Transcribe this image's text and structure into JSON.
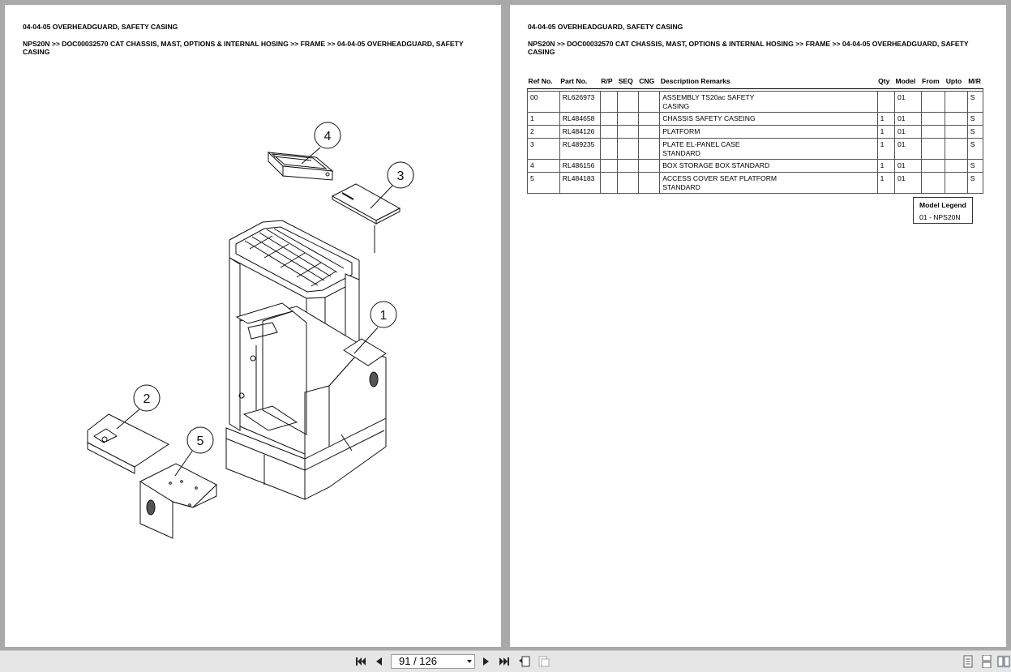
{
  "left_page": {
    "title": "04-04-05 OVERHEADGUARD, SAFETY CASING",
    "breadcrumb": "NPS20N >> DOC00032570 CAT CHASSIS, MAST, OPTIONS & INTERNAL HOSING >> FRAME >> 04-04-05 OVERHEADGUARD, SAFETY CASING",
    "callouts": [
      "4",
      "3",
      "1",
      "2",
      "5"
    ]
  },
  "right_page": {
    "title": "04-04-05 OVERHEADGUARD, SAFETY CASING",
    "breadcrumb": "NPS20N >> DOC00032570 CAT CHASSIS, MAST, OPTIONS & INTERNAL HOSING >> FRAME >> 04-04-05 OVERHEADGUARD, SAFETY CASING",
    "table": {
      "headers": [
        "Ref No.",
        "Part No.",
        "R/P",
        "SEQ",
        "CNG",
        "Description Remarks",
        "Qty",
        "Model",
        "From",
        "Upto",
        "M/R"
      ],
      "rows": [
        {
          "ref": "00",
          "part": "RL626973",
          "rp": "",
          "seq": "",
          "cng": "",
          "desc": "ASSEMBLY TS20ac SAFETY\nCASING",
          "qty": "",
          "model": "01",
          "from": "",
          "upto": "",
          "mr": "S"
        },
        {
          "ref": "1",
          "part": "RL484658",
          "rp": "",
          "seq": "",
          "cng": "",
          "desc": "CHASSIS SAFETY CASEING",
          "qty": "1",
          "model": "01",
          "from": "",
          "upto": "",
          "mr": "S"
        },
        {
          "ref": "2",
          "part": "RL484126",
          "rp": "",
          "seq": "",
          "cng": "",
          "desc": "PLATFORM",
          "qty": "1",
          "model": "01",
          "from": "",
          "upto": "",
          "mr": "S"
        },
        {
          "ref": "3",
          "part": "RL489235",
          "rp": "",
          "seq": "",
          "cng": "",
          "desc": "PLATE EL-PANEL CASE\nSTANDARD",
          "qty": "1",
          "model": "01",
          "from": "",
          "upto": "",
          "mr": "S"
        },
        {
          "ref": "4",
          "part": "RL486156",
          "rp": "",
          "seq": "",
          "cng": "",
          "desc": "BOX STORAGE BOX STANDARD",
          "qty": "1",
          "model": "01",
          "from": "",
          "upto": "",
          "mr": "S"
        },
        {
          "ref": "5",
          "part": "RL484183",
          "rp": "",
          "seq": "",
          "cng": "",
          "desc": "ACCESS COVER SEAT PLATFORM\nSTANDARD",
          "qty": "1",
          "model": "01",
          "from": "",
          "upto": "",
          "mr": "S"
        }
      ]
    },
    "legend": {
      "title": "Model Legend",
      "items": [
        "01 - NPS20N"
      ]
    }
  },
  "toolbar": {
    "page_indicator": "91 / 126",
    "icons": [
      "first-page-icon",
      "prev-page-icon",
      "next-page-icon",
      "last-page-icon",
      "back-view-icon",
      "forward-view-icon",
      "single-page-icon",
      "continuous-icon",
      "two-page-icon"
    ]
  }
}
